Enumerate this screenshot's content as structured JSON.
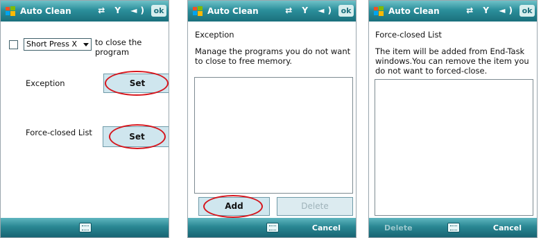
{
  "app_title": "Auto Clean",
  "ok_label": "ok",
  "screen1": {
    "dropdown_value": "Short Press X",
    "close_text_line1": "to close the",
    "close_text_line2": "program",
    "exception_label": "Exception",
    "exception_button": "Set",
    "force_label": "Force-closed List",
    "force_button": "Set"
  },
  "screen2": {
    "heading": "Exception",
    "desc_line1": "Manage the programs you do not want",
    "desc_line2": "to close to free memory.",
    "add_button": "Add",
    "delete_button": "Delete",
    "right_softkey": "Cancel"
  },
  "screen3": {
    "heading": "Force-closed List",
    "desc_line1": "The item will be added from End-Task",
    "desc_line2": "windows.You can remove the item you",
    "desc_line3": "do not want to forced-close.",
    "left_softkey": "Delete",
    "right_softkey": "Cancel"
  },
  "icons": [
    "windows-logo-icon",
    "connectivity-icon",
    "signal-icon",
    "volume-icon",
    "keyboard-icon"
  ],
  "colors": {
    "titlebar": "#2b8f9b",
    "highlight": "#d6151c",
    "button": "#cfe6ee"
  }
}
